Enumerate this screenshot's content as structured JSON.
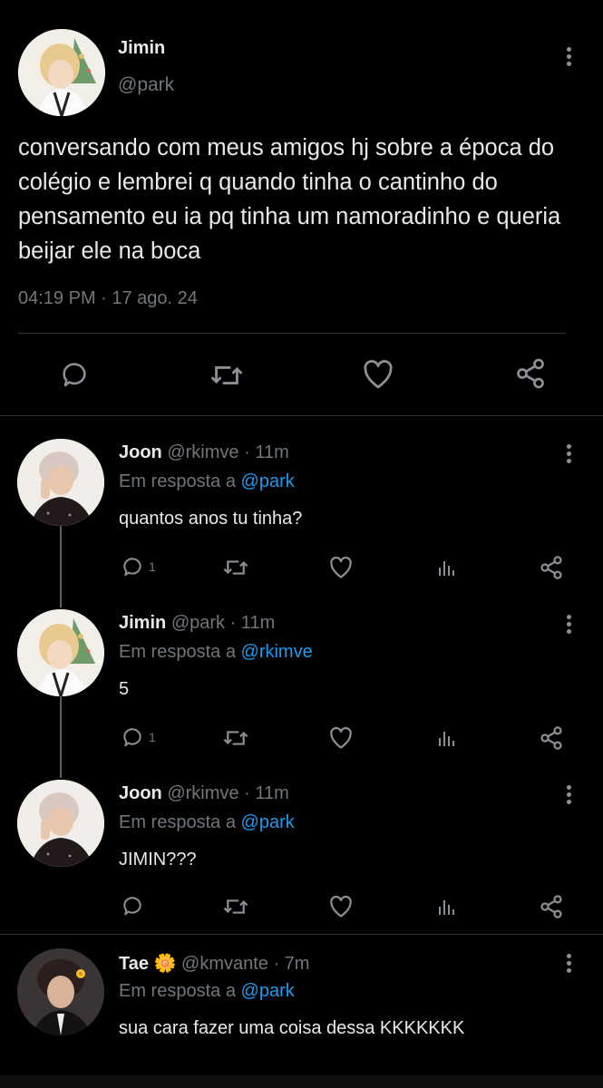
{
  "main_tweet": {
    "author_name": "Jimin",
    "handle": "@park",
    "text": "conversando com meus amigos hj sobre a época do colégio e lembrei q quando tinha o cantinho do pensamento eu ia pq tinha um namoradinho e queria beijar ele na boca",
    "timestamp": "04:19 PM · 17 ago. 24",
    "actions": [
      "reply-icon",
      "retweet-icon",
      "like-icon",
      "share-icon"
    ]
  },
  "replies": [
    {
      "author_name": "Joon",
      "handle": "@rkimve",
      "time": "· 11m",
      "reply_prefix": "Em resposta a",
      "reply_to": "@park",
      "text": "quantos anos tu tinha?",
      "reply_count": "1"
    },
    {
      "author_name": "Jimin",
      "handle": "@park",
      "time": "· 11m",
      "reply_prefix": "Em resposta a",
      "reply_to": "@rkimve",
      "text": "5",
      "reply_count": "1"
    },
    {
      "author_name": "Joon",
      "handle": "@rkimve",
      "time": "· 11m",
      "reply_prefix": "Em resposta a",
      "reply_to": "@park",
      "text": "JIMIN???",
      "reply_count": ""
    },
    {
      "author_name": "Tae",
      "name_emoji": "🌼",
      "handle": "@kmvante",
      "time": "· 7m",
      "reply_prefix": "Em resposta a",
      "reply_to": "@park",
      "text": "sua cara fazer uma coisa dessa KKKKKKK"
    }
  ],
  "colors": {
    "background": "#000000",
    "text": "#e7e9ea",
    "muted": "#71767b",
    "link": "#1d9bf0"
  }
}
